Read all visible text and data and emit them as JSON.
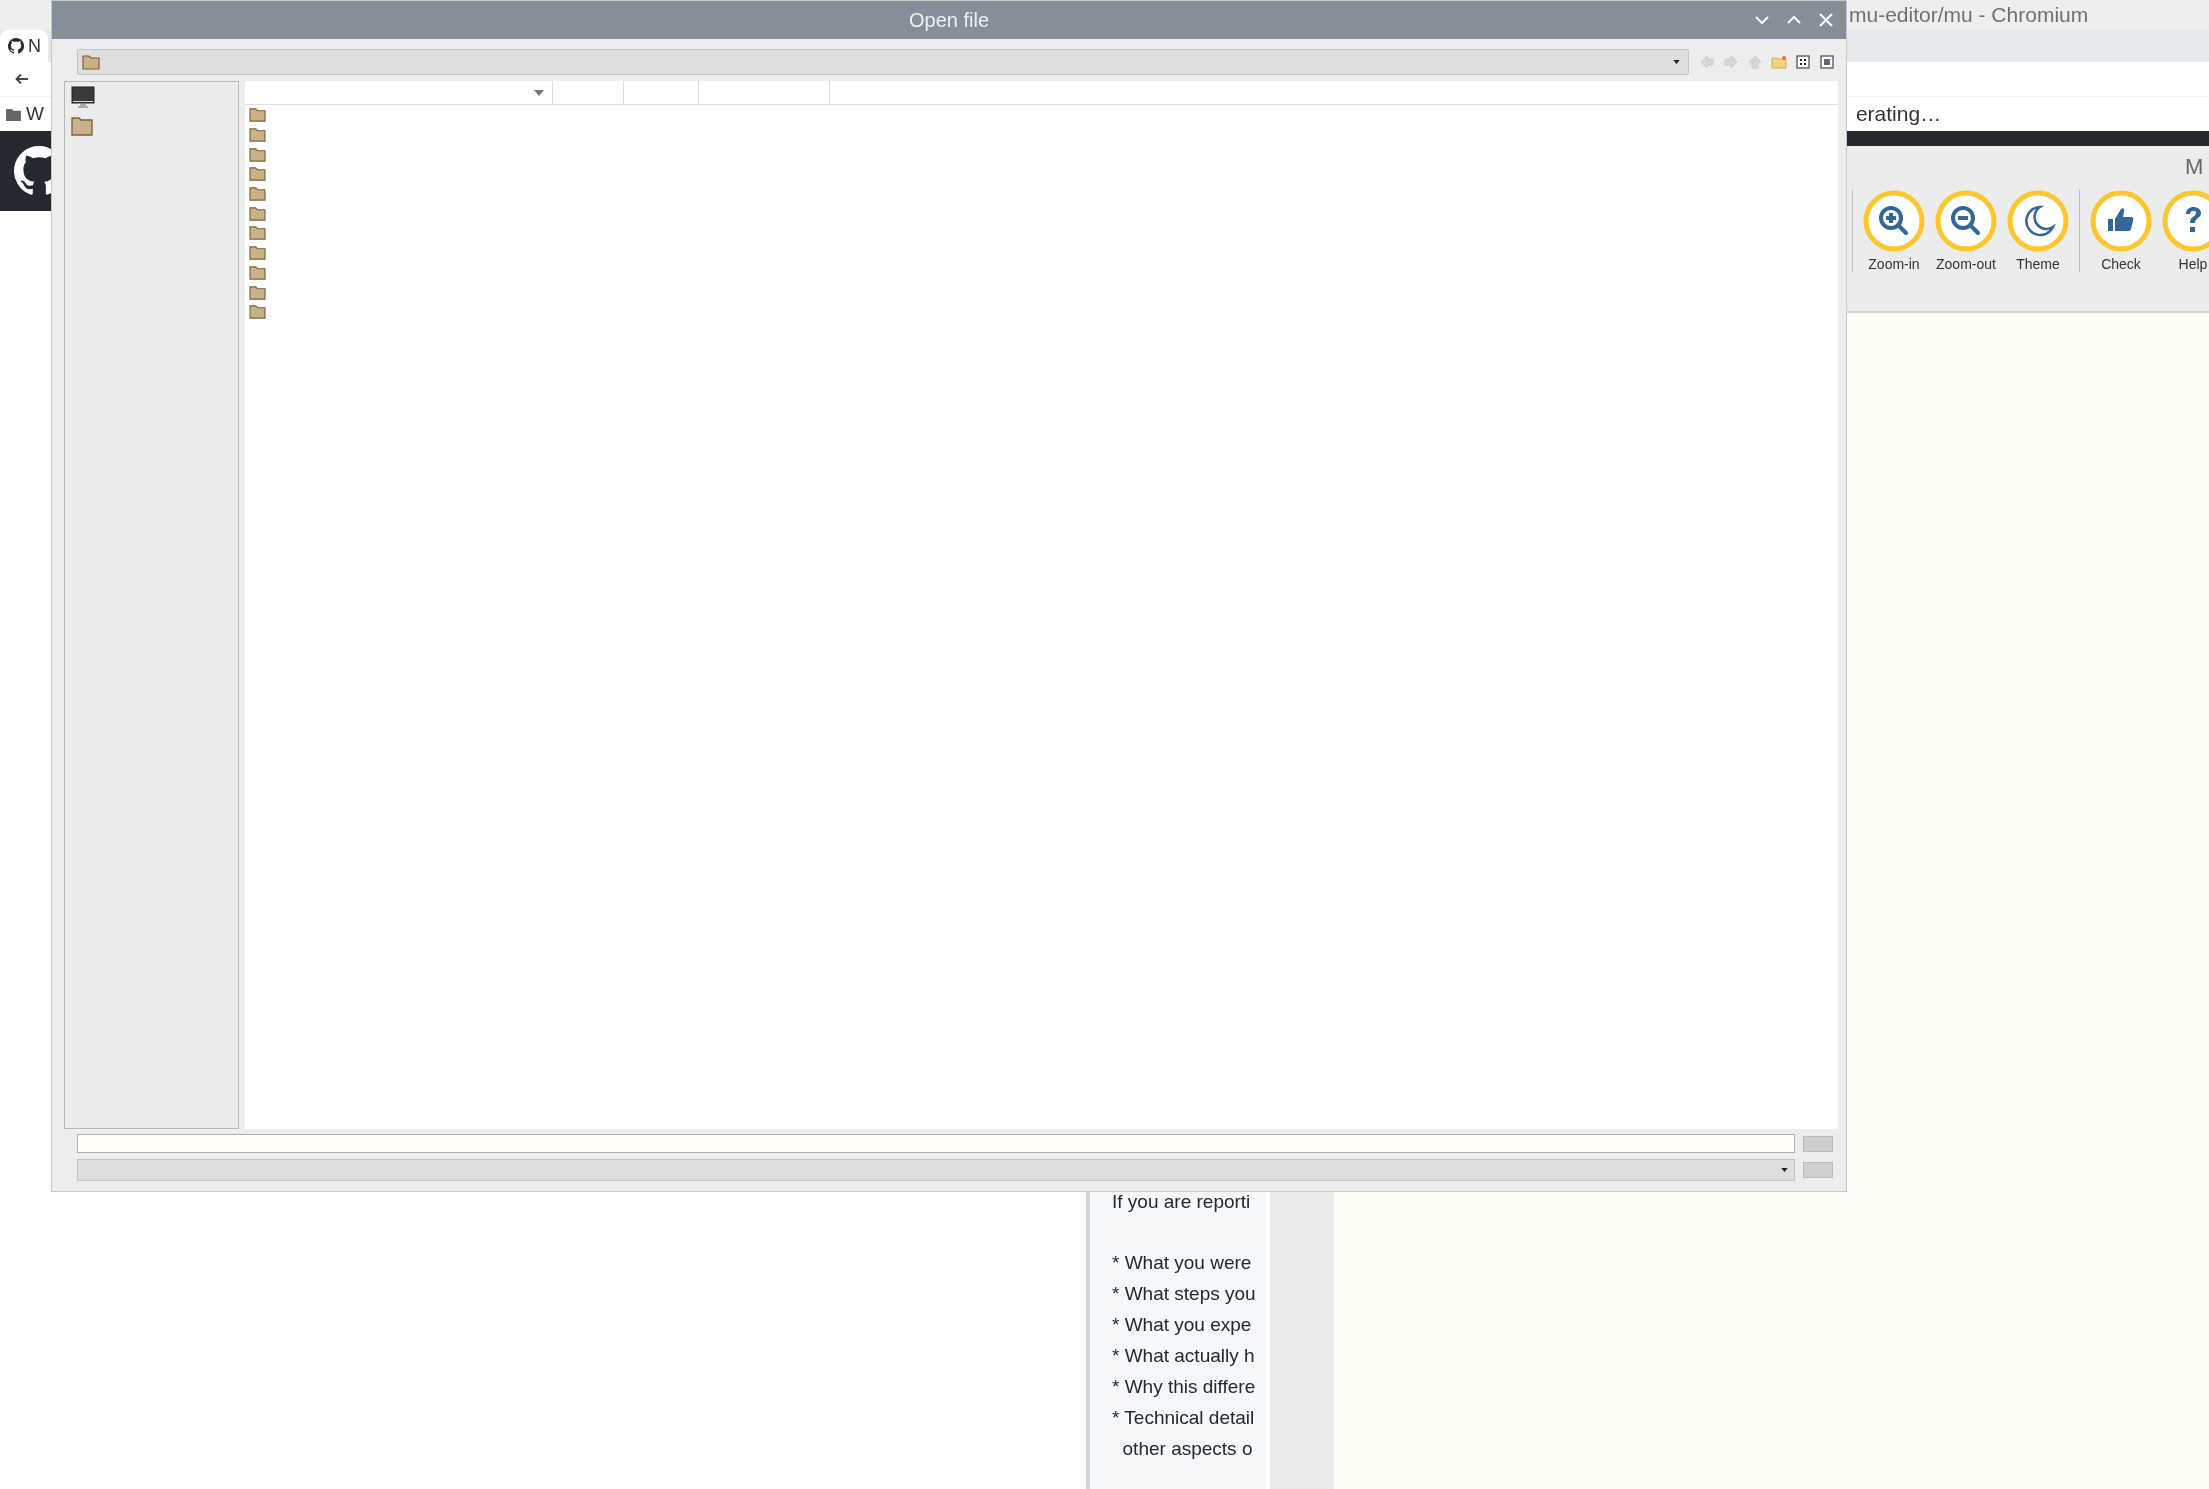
{
  "browser": {
    "title": "mu-editor/mu - Chromium",
    "tab": {
      "label": "N"
    },
    "bookmark": {
      "label": "W"
    },
    "banner": "erating…",
    "issue_lines": [
      "If you are reporti",
      "* What you were",
      "* What steps you",
      "* What you expe",
      "* What actually h",
      "* Why this differe",
      "* Technical detail",
      "  other aspects o"
    ]
  },
  "mu": {
    "title": "M",
    "buttons": [
      {
        "kind": "zoom-in",
        "label": "Zoom-in",
        "separator_before": true
      },
      {
        "kind": "zoom-out",
        "label": "Zoom-out",
        "separator_before": false
      },
      {
        "kind": "theme",
        "label": "Theme",
        "separator_before": false
      },
      {
        "kind": "check",
        "label": "Check",
        "separator_before": true
      },
      {
        "kind": "help",
        "label": "Help",
        "separator_before": false
      }
    ]
  },
  "dialog": {
    "title": "Open file",
    "toolbar": [
      {
        "kind": "back",
        "disabled": true
      },
      {
        "kind": "forward",
        "disabled": true
      },
      {
        "kind": "up",
        "disabled": true
      },
      {
        "kind": "new-folder",
        "disabled": false
      },
      {
        "kind": "list-view",
        "disabled": false
      },
      {
        "kind": "detail-view",
        "disabled": false
      }
    ],
    "sidebar": [
      {
        "kind": "computer"
      },
      {
        "kind": "folder"
      }
    ],
    "columns": [
      {
        "sorted": true
      },
      {
        "sorted": false
      },
      {
        "sorted": false
      },
      {
        "sorted": false
      }
    ],
    "rows": [
      {
        "kind": "folder"
      },
      {
        "kind": "folder"
      },
      {
        "kind": "folder"
      },
      {
        "kind": "folder"
      },
      {
        "kind": "folder"
      },
      {
        "kind": "folder"
      },
      {
        "kind": "folder"
      },
      {
        "kind": "folder"
      },
      {
        "kind": "folder"
      },
      {
        "kind": "folder"
      },
      {
        "kind": "folder"
      }
    ]
  }
}
